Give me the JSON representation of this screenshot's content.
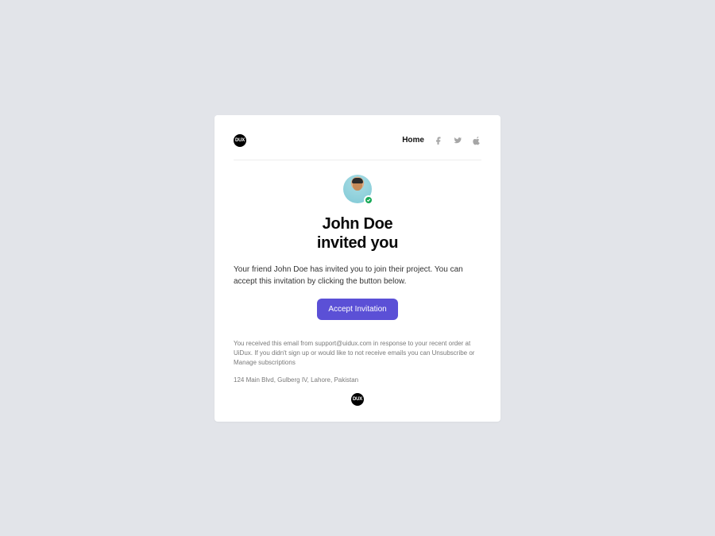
{
  "logo_text": "DUX",
  "nav": {
    "home_label": "Home",
    "icons": [
      "facebook-icon",
      "twitter-icon",
      "apple-icon"
    ]
  },
  "inviter_name": "John Doe",
  "title_line1": "John Doe",
  "title_line2": "invited you",
  "description": "Your friend John Doe has invited you to join their project. You can accept this invitation by clicking the button below.",
  "cta_label": "Accept Invitation",
  "footer": {
    "disclaimer": "You received this email from support@uidux.com in response to your recent order at UiDux. If you didn't sign up or would like to not receive emails you can Unsubscribe or Manage subscriptions",
    "address": "124 Main Blvd, Gulberg IV, Lahore, Pakistan"
  },
  "colors": {
    "page_bg": "#E2E4E9",
    "card_bg": "#FFFFFF",
    "primary": "#5B50D6",
    "success": "#18A957",
    "text": "#0A0A0A",
    "muted": "#7A7A7A"
  }
}
